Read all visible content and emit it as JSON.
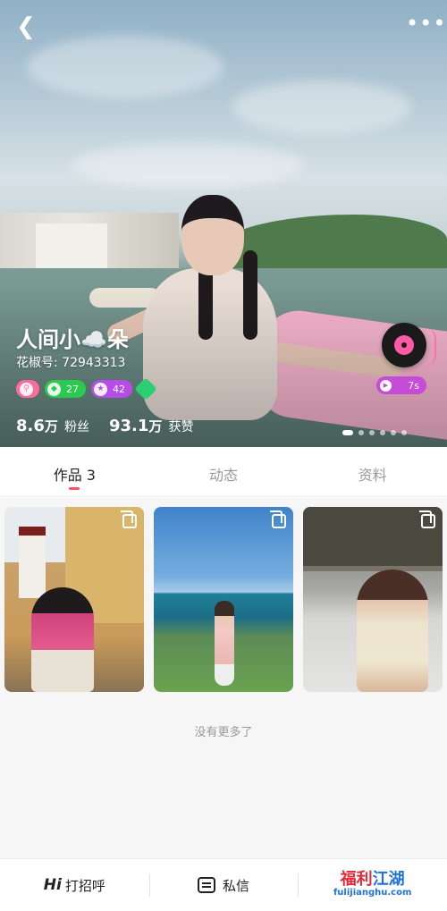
{
  "profile": {
    "nickname": "人间小☁️朵",
    "pepper_id": "花椒号: 72943313",
    "badges": [
      {
        "name": "level-badge",
        "value": "",
        "color": "#ff6b9a"
      },
      {
        "name": "diamond-badge",
        "value": "27",
        "color": "#2ac94f"
      },
      {
        "name": "star-badge",
        "value": "42",
        "color": "#b54de6"
      },
      {
        "name": "hex-badge",
        "value": "",
        "color": "#2ccf70"
      }
    ],
    "stats": {
      "fans_num": "8.6",
      "fans_unit": "万",
      "fans_label": "粉丝",
      "likes_num": "93.1",
      "likes_unit": "万",
      "likes_label": "获赞"
    },
    "voice_duration": "7s",
    "carousel_total": 6,
    "carousel_active": 1
  },
  "icons": {
    "back": "back-arrow-icon",
    "more": "more-icon",
    "voice": "vinyl-record-icon",
    "play": "play-icon",
    "multi": "multi-image-icon",
    "message": "message-icon"
  },
  "tabs": [
    {
      "label": "作品 3",
      "active": true
    },
    {
      "label": "动态",
      "active": false
    },
    {
      "label": "资料",
      "active": false
    }
  ],
  "no_more_text": "没有更多了",
  "bottom_bar": {
    "greet_hi": "Hi",
    "greet_label": "打招呼",
    "message_label": "私信"
  },
  "watermark": {
    "title_a": "福利",
    "title_b": "江湖",
    "url": "fulijianghu.com"
  },
  "colors": {
    "accent": "#ff4f62",
    "voice_pill": "#c64bd7",
    "disc_center": "#ff5aa5"
  }
}
